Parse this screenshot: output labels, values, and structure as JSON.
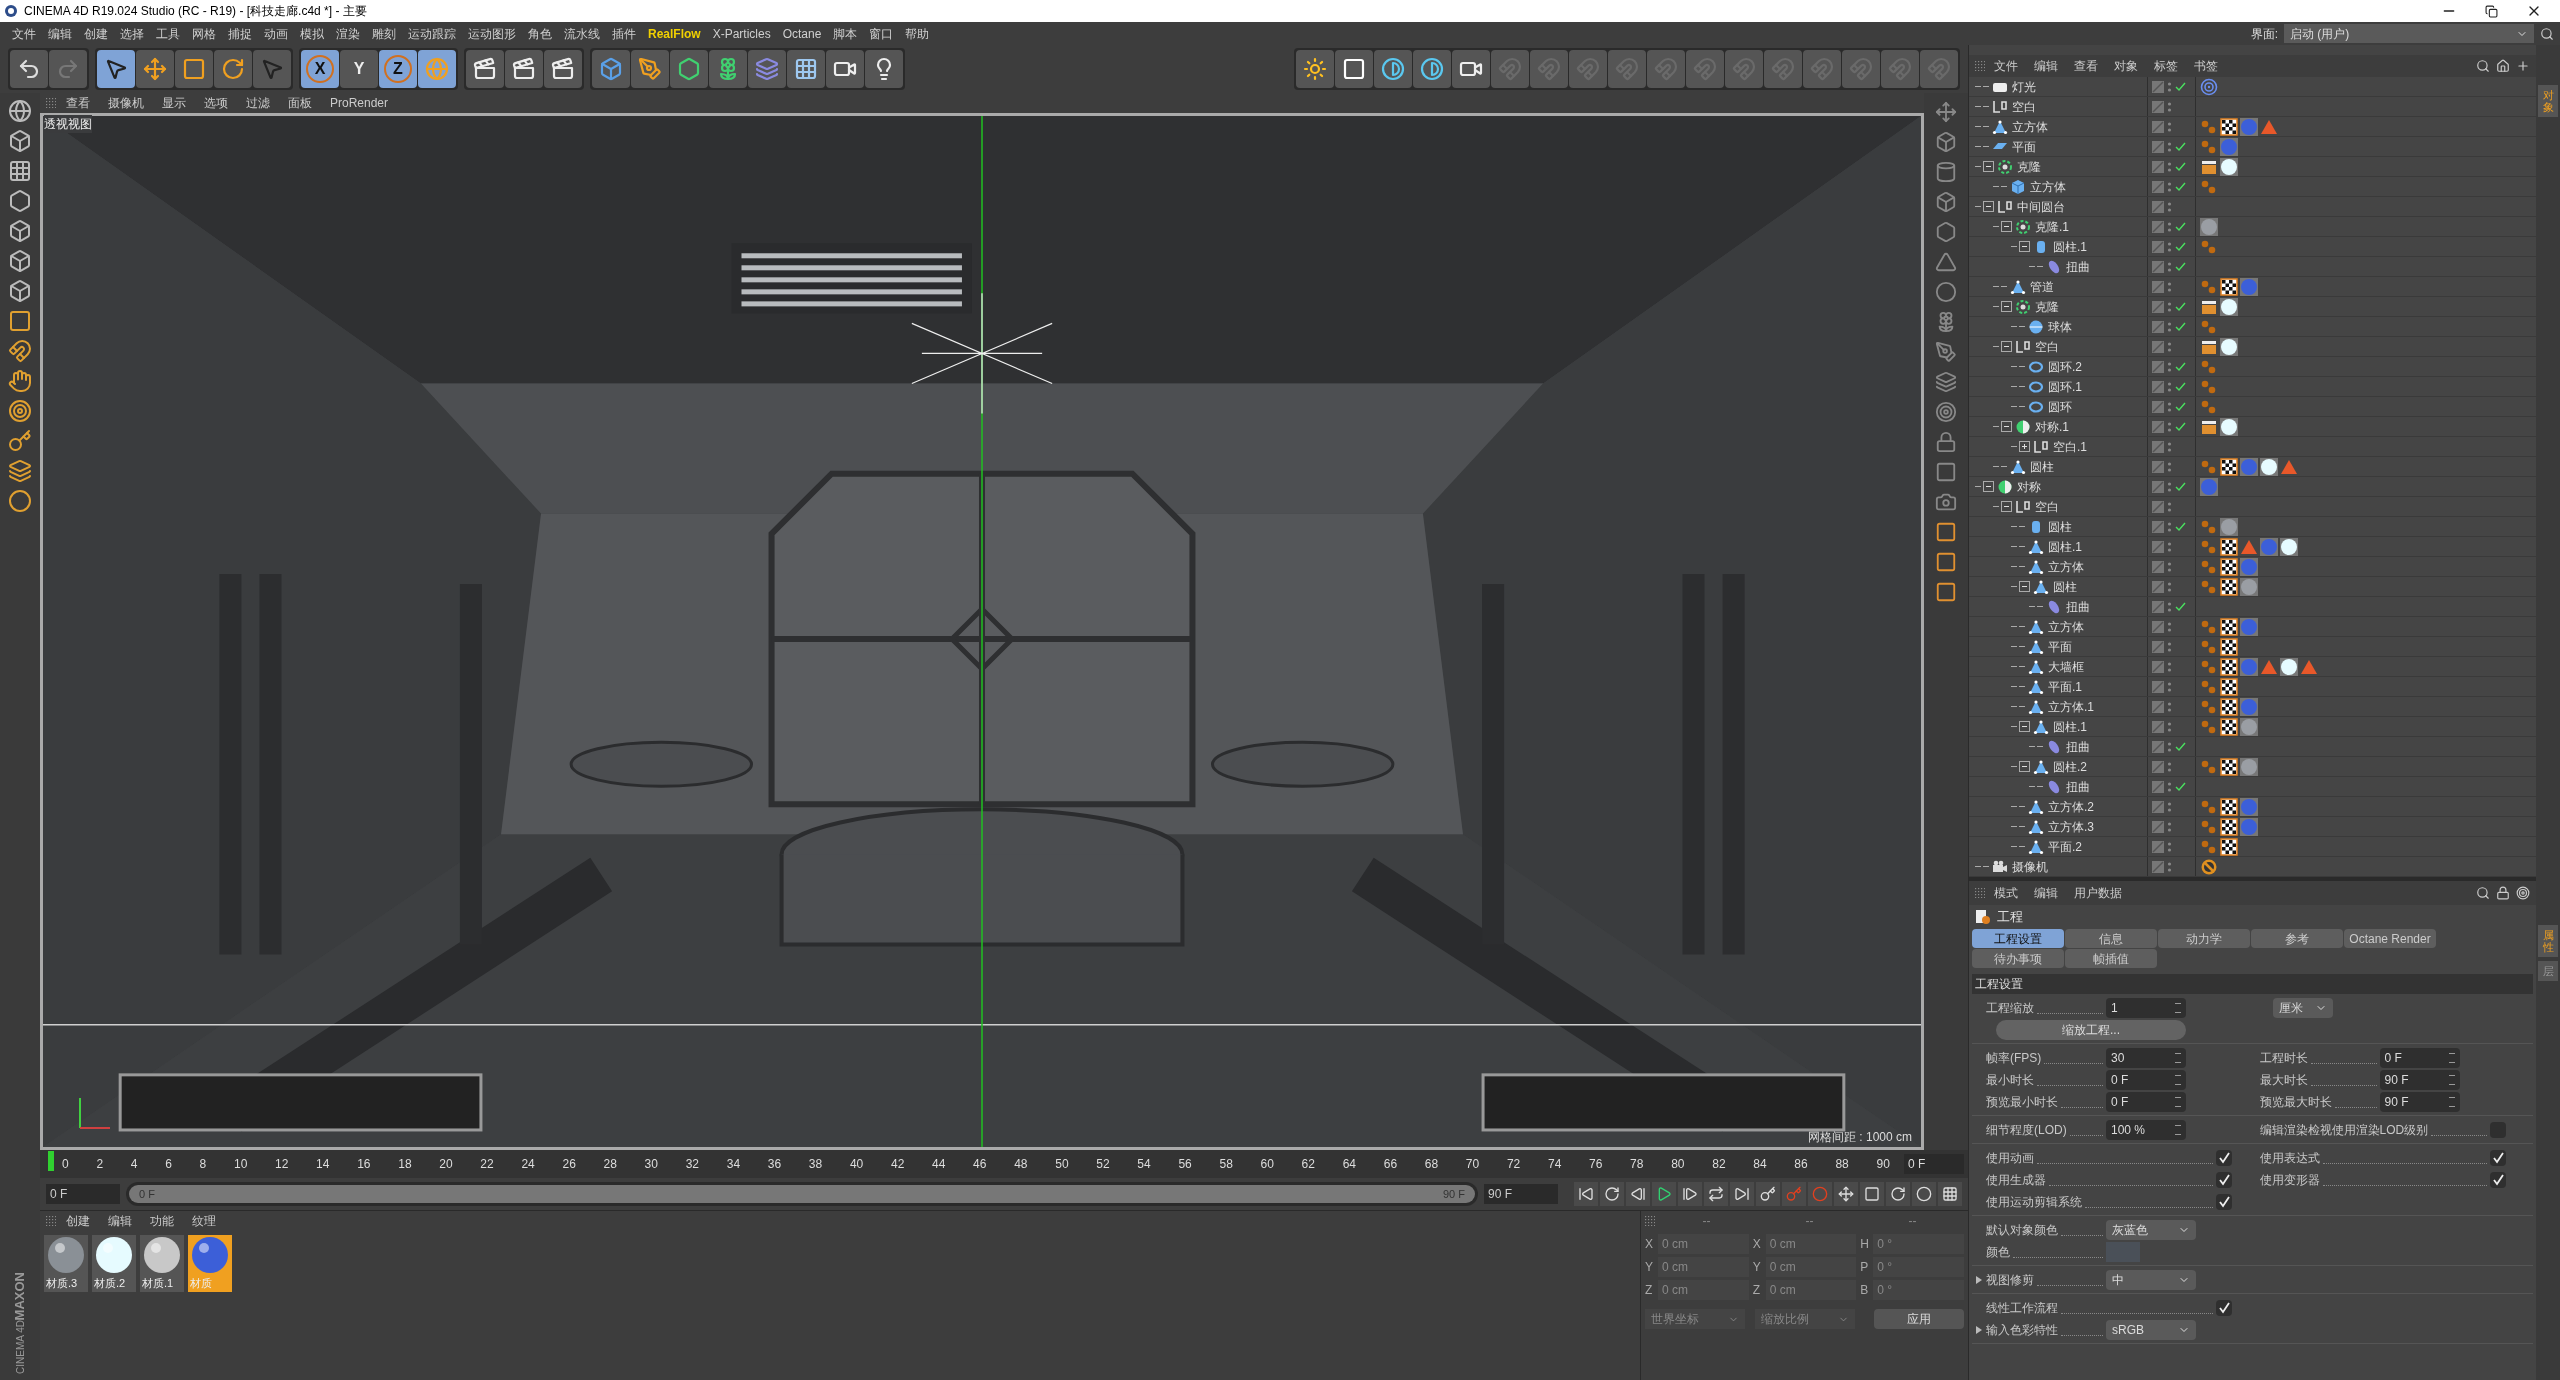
{
  "window": {
    "title": "CINEMA 4D R19.024 Studio (RC - R19) - [科技走廊.c4d *] - 主要"
  },
  "menu": [
    {
      "label": "文件",
      "highlighted": false
    },
    {
      "label": "编辑",
      "highlighted": false
    },
    {
      "label": "创建",
      "highlighted": false
    },
    {
      "label": "选择",
      "highlighted": false
    },
    {
      "label": "工具",
      "highlighted": false
    },
    {
      "label": "网格",
      "highlighted": false
    },
    {
      "label": "捕捉",
      "highlighted": false
    },
    {
      "label": "动画",
      "highlighted": false
    },
    {
      "label": "模拟",
      "highlighted": false
    },
    {
      "label": "渲染",
      "highlighted": false
    },
    {
      "label": "雕刻",
      "highlighted": false
    },
    {
      "label": "运动跟踪",
      "highlighted": false
    },
    {
      "label": "运动图形",
      "highlighted": false
    },
    {
      "label": "角色",
      "highlighted": false
    },
    {
      "label": "流水线",
      "highlighted": false
    },
    {
      "label": "插件",
      "highlighted": false
    },
    {
      "label": "RealFlow",
      "highlighted": true
    },
    {
      "label": "X-Particles",
      "highlighted": false
    },
    {
      "label": "Octane",
      "highlighted": false
    },
    {
      "label": "脚本",
      "highlighted": false
    },
    {
      "label": "窗口",
      "highlighted": false
    },
    {
      "label": "帮助",
      "highlighted": false
    }
  ],
  "layout": {
    "label": "界面:",
    "value": "启动 (用户)"
  },
  "toolbar": [
    [
      {
        "kind": "undo",
        "active": false
      },
      {
        "kind": "redo",
        "active": false
      }
    ],
    [
      {
        "kind": "select",
        "active": true
      },
      {
        "kind": "move",
        "active": false
      },
      {
        "kind": "scale",
        "active": false
      },
      {
        "kind": "rotate",
        "active": false
      },
      {
        "kind": "select",
        "active": false
      }
    ],
    [
      {
        "kind": "axis",
        "label": "X",
        "active": true
      },
      {
        "kind": "axis",
        "label": "Y",
        "active": false
      },
      {
        "kind": "axis",
        "label": "Z",
        "active": true
      },
      {
        "kind": "world",
        "active": true
      }
    ],
    [
      {
        "kind": "render",
        "active": false
      },
      {
        "kind": "render",
        "active": false
      },
      {
        "kind": "render",
        "active": false
      }
    ],
    [
      {
        "kind": "cube",
        "active": false
      },
      {
        "kind": "pen",
        "active": false
      },
      {
        "kind": "subdivide",
        "active": false
      },
      {
        "kind": "cloner",
        "active": false
      },
      {
        "kind": "deformer",
        "active": false
      },
      {
        "kind": "floor",
        "active": false
      },
      {
        "kind": "camera",
        "active": false
      },
      {
        "kind": "light",
        "active": false
      }
    ]
  ],
  "toolbar_right": [
    {
      "kind": "sun"
    },
    {
      "kind": "lamp"
    },
    {
      "kind": "contrast"
    },
    {
      "kind": "contrast"
    },
    {
      "kind": "camera"
    },
    {
      "kind": "faded"
    },
    {
      "kind": "faded"
    },
    {
      "kind": "faded"
    },
    {
      "kind": "faded"
    },
    {
      "kind": "faded"
    },
    {
      "kind": "faded"
    },
    {
      "kind": "faded"
    },
    {
      "kind": "faded"
    },
    {
      "kind": "faded"
    },
    {
      "kind": "faded"
    },
    {
      "kind": "faded"
    },
    {
      "kind": "faded"
    }
  ],
  "viewport": {
    "menu": [
      "查看",
      "摄像机",
      "显示",
      "选项",
      "过滤",
      "面板",
      "ProRender"
    ],
    "name": "透视视图",
    "grid": "网格间距 : 1000 cm"
  },
  "objects_panel": {
    "menu": [
      "文件",
      "编辑",
      "查看",
      "对象",
      "标签",
      "书签"
    ],
    "side_tab": "对象"
  },
  "objects": [
    {
      "name": "灯光",
      "kind": "light",
      "visible": true,
      "tags": [
        {
          "kind": "target"
        }
      ]
    },
    {
      "name": "空白",
      "kind": "null",
      "visible": false
    },
    {
      "name": "立方体",
      "kind": "poly",
      "visible": false,
      "tags": [
        {
          "kind": "phong"
        },
        {
          "kind": "checker"
        },
        {
          "kind": "material",
          "color": "#3c5fd8"
        },
        {
          "kind": "triangle"
        }
      ]
    },
    {
      "name": "平面",
      "kind": "plane",
      "visible": true,
      "tags": [
        {
          "kind": "phong"
        },
        {
          "kind": "material",
          "color": "#3c5fd8"
        }
      ]
    },
    {
      "name": "克隆",
      "kind": "cloner",
      "visible": true,
      "expanded": true,
      "tags": [
        {
          "kind": "clapper"
        },
        {
          "kind": "material",
          "color": "#e6fbff"
        }
      ],
      "children": [
        {
          "name": "立方体",
          "kind": "cube",
          "visible": true,
          "tags": [
            {
              "kind": "phong"
            }
          ]
        }
      ]
    },
    {
      "name": "中间圆台",
      "kind": "null",
      "visible": false,
      "expanded": true,
      "children": [
        {
          "name": "克隆.1",
          "kind": "cloner",
          "visible": true,
          "expanded": true,
          "tags": [
            {
              "kind": "material",
              "color": "#9a9ea4"
            }
          ],
          "children": [
            {
              "name": "圆柱.1",
              "kind": "cylinder",
              "visible": true,
              "expanded": true,
              "tags": [
                {
                  "kind": "phong"
                }
              ],
              "children": [
                {
                  "name": "扭曲",
                  "kind": "deformer",
                  "visible": true
                }
              ]
            }
          ]
        },
        {
          "name": "管道",
          "kind": "poly",
          "visible": false,
          "tags": [
            {
              "kind": "phong"
            },
            {
              "kind": "checker"
            },
            {
              "kind": "material",
              "color": "#3c5fd8"
            }
          ]
        },
        {
          "name": "克隆",
          "kind": "cloner",
          "visible": true,
          "expanded": true,
          "tags": [
            {
              "kind": "clapper"
            },
            {
              "kind": "material",
              "color": "#e6fbff"
            }
          ],
          "children": [
            {
              "name": "球体",
              "kind": "sphere",
              "visible": true,
              "tags": [
                {
                  "kind": "phong"
                }
              ]
            }
          ]
        },
        {
          "name": "空白",
          "kind": "null",
          "visible": false,
          "expanded": true,
          "tags": [
            {
              "kind": "clapper"
            },
            {
              "kind": "material",
              "color": "#e6fbff"
            }
          ],
          "children": [
            {
              "name": "圆环.2",
              "kind": "ring",
              "visible": true,
              "tags": [
                {
                  "kind": "phong"
                }
              ]
            },
            {
              "name": "圆环.1",
              "kind": "ring",
              "visible": true,
              "tags": [
                {
                  "kind": "phong"
                }
              ]
            },
            {
              "name": "圆环",
              "kind": "ring",
              "visible": true,
              "tags": [
                {
                  "kind": "phong"
                }
              ]
            }
          ]
        },
        {
          "name": "对称.1",
          "kind": "symmetry",
          "visible": true,
          "expanded": true,
          "tags": [
            {
              "kind": "clapper"
            },
            {
              "kind": "material",
              "color": "#e6fbff"
            }
          ],
          "children": [
            {
              "name": "空白.1",
              "kind": "null",
              "visible": false,
              "expanded": false
            }
          ]
        },
        {
          "name": "圆柱",
          "kind": "poly",
          "visible": false,
          "tags": [
            {
              "kind": "phong"
            },
            {
              "kind": "checker"
            },
            {
              "kind": "material",
              "color": "#3c5fd8"
            },
            {
              "kind": "material",
              "color": "#e6fbff"
            },
            {
              "kind": "triangle"
            }
          ]
        }
      ]
    },
    {
      "name": "对称",
      "kind": "symmetry",
      "visible": true,
      "expanded": true,
      "tags": [
        {
          "kind": "material",
          "color": "#3c5fd8"
        }
      ],
      "children": [
        {
          "name": "空白",
          "kind": "null",
          "visible": false,
          "expanded": true,
          "children": [
            {
              "name": "圆柱",
              "kind": "cylinder",
              "visible": true,
              "tags": [
                {
                  "kind": "phong"
                },
                {
                  "kind": "material",
                  "color": "#9a9ea4"
                }
              ]
            },
            {
              "name": "圆柱.1",
              "kind": "poly",
              "visible": false,
              "tags": [
                {
                  "kind": "phong"
                },
                {
                  "kind": "checker"
                },
                {
                  "kind": "triangle"
                },
                {
                  "kind": "material",
                  "color": "#3c5fd8"
                },
                {
                  "kind": "material",
                  "color": "#e6fbff"
                }
              ]
            },
            {
              "name": "立方体",
              "kind": "poly",
              "visible": false,
              "tags": [
                {
                  "kind": "phong"
                },
                {
                  "kind": "checker"
                },
                {
                  "kind": "material",
                  "color": "#3c5fd8"
                }
              ]
            },
            {
              "name": "圆柱",
              "kind": "poly",
              "visible": false,
              "expanded": true,
              "tags": [
                {
                  "kind": "phong"
                },
                {
                  "kind": "checker"
                },
                {
                  "kind": "material",
                  "color": "#9a9ea4"
                }
              ],
              "children": [
                {
                  "name": "扭曲",
                  "kind": "deformer",
                  "visible": true
                }
              ]
            },
            {
              "name": "立方体",
              "kind": "poly",
              "visible": false,
              "tags": [
                {
                  "kind": "phong"
                },
                {
                  "kind": "checker"
                },
                {
                  "kind": "material",
                  "color": "#3c5fd8"
                }
              ]
            },
            {
              "name": "平面",
              "kind": "poly",
              "visible": false,
              "tags": [
                {
                  "kind": "phong"
                },
                {
                  "kind": "checker"
                }
              ]
            },
            {
              "name": "大墙框",
              "kind": "poly",
              "visible": false,
              "tags": [
                {
                  "kind": "phong"
                },
                {
                  "kind": "checker"
                },
                {
                  "kind": "material",
                  "color": "#3c5fd8"
                },
                {
                  "kind": "triangle"
                },
                {
                  "kind": "material",
                  "color": "#e6fbff"
                },
                {
                  "kind": "triangle"
                }
              ]
            },
            {
              "name": "平面.1",
              "kind": "poly",
              "visible": false,
              "tags": [
                {
                  "kind": "phong"
                },
                {
                  "kind": "checker"
                }
              ]
            },
            {
              "name": "立方体.1",
              "kind": "poly",
              "visible": false,
              "tags": [
                {
                  "kind": "phong"
                },
                {
                  "kind": "checker"
                },
                {
                  "kind": "material",
                  "color": "#3c5fd8"
                }
              ]
            },
            {
              "name": "圆柱.1",
              "kind": "poly",
              "visible": false,
              "expanded": true,
              "tags": [
                {
                  "kind": "phong"
                },
                {
                  "kind": "checker"
                },
                {
                  "kind": "material",
                  "color": "#9a9ea4"
                }
              ],
              "children": [
                {
                  "name": "扭曲",
                  "kind": "deformer",
                  "visible": true
                }
              ]
            },
            {
              "name": "圆柱.2",
              "kind": "poly",
              "visible": false,
              "expanded": true,
              "tags": [
                {
                  "kind": "phong"
                },
                {
                  "kind": "checker"
                },
                {
                  "kind": "material",
                  "color": "#9a9ea4"
                }
              ],
              "children": [
                {
                  "name": "扭曲",
                  "kind": "deformer",
                  "visible": true
                }
              ]
            },
            {
              "name": "立方体.2",
              "kind": "poly",
              "visible": false,
              "tags": [
                {
                  "kind": "phong"
                },
                {
                  "kind": "checker"
                },
                {
                  "kind": "material",
                  "color": "#3c5fd8"
                }
              ]
            },
            {
              "name": "立方体.3",
              "kind": "poly",
              "visible": false,
              "tags": [
                {
                  "kind": "phong"
                },
                {
                  "kind": "checker"
                },
                {
                  "kind": "material",
                  "color": "#3c5fd8"
                }
              ]
            },
            {
              "name": "平面.2",
              "kind": "poly",
              "visible": false,
              "tags": [
                {
                  "kind": "phong"
                },
                {
                  "kind": "checker"
                }
              ]
            }
          ]
        }
      ]
    },
    {
      "name": "摄像机",
      "kind": "camera",
      "visible": false,
      "tags": [
        {
          "kind": "prohibited"
        }
      ]
    }
  ],
  "attributes": {
    "menu": [
      "模式",
      "编辑",
      "用户数据"
    ],
    "side_tabs": [
      "属性",
      "层"
    ],
    "title": "工程",
    "tabs": [
      [
        {
          "label": "工程设置",
          "selected": true
        },
        {
          "label": "信息",
          "selected": false
        },
        {
          "label": "动力学",
          "selected": false
        },
        {
          "label": "参考",
          "selected": false
        },
        {
          "label": "Octane Render",
          "selected": false
        }
      ],
      [
        {
          "label": "待办事项",
          "selected": false
        },
        {
          "label": "帧插值",
          "selected": false
        }
      ]
    ],
    "section": "工程设置",
    "groups": [
      [
        [
          {
            "kind": "number",
            "label": "工程缩放",
            "value": "1"
          },
          {
            "kind": "unit",
            "value": "厘米"
          }
        ],
        [
          {
            "kind": "button",
            "value": "缩放工程..."
          }
        ]
      ],
      [
        [
          {
            "kind": "number",
            "label": "帧率(FPS)",
            "value": "30"
          },
          {
            "kind": "number",
            "label": "工程时长",
            "value": "0 F"
          }
        ],
        [
          {
            "kind": "number",
            "label": "最小时长",
            "value": "0 F"
          },
          {
            "kind": "number",
            "label": "最大时长",
            "value": "90 F"
          }
        ],
        [
          {
            "kind": "number",
            "label": "预览最小时长",
            "value": "0 F"
          },
          {
            "kind": "number",
            "label": "预览最大时长",
            "value": "90 F"
          }
        ]
      ],
      [
        [
          {
            "kind": "number",
            "label": "细节程度(LOD)",
            "value": "100 %"
          },
          {
            "kind": "check",
            "label": "编辑渲染检视使用渲染LOD级别",
            "checked": false
          }
        ]
      ],
      [
        [
          {
            "kind": "check",
            "label": "使用动画",
            "checked": true
          },
          {
            "kind": "check",
            "label": "使用表达式",
            "checked": true
          }
        ],
        [
          {
            "kind": "check",
            "label": "使用生成器",
            "checked": true
          },
          {
            "kind": "check",
            "label": "使用变形器",
            "checked": true
          }
        ],
        [
          {
            "kind": "check",
            "label": "使用运动剪辑系统",
            "checked": true
          }
        ]
      ],
      [
        [
          {
            "kind": "dropdown",
            "label": "默认对象颜色",
            "value": "灰蓝色"
          }
        ],
        [
          {
            "kind": "color",
            "label": "颜色",
            "color": "#4a5058"
          }
        ]
      ],
      [
        [
          {
            "kind": "dropdown",
            "label": "视图修剪",
            "value": "中",
            "expander": true
          }
        ]
      ],
      [
        [
          {
            "kind": "check",
            "label": "线性工作流程",
            "checked": true
          }
        ],
        [
          {
            "kind": "dropdown",
            "label": "输入色彩特性",
            "value": "sRGB",
            "expander": true
          }
        ]
      ]
    ]
  },
  "timeline": {
    "ticks": [
      "0",
      "2",
      "4",
      "6",
      "8",
      "10",
      "12",
      "14",
      "16",
      "18",
      "20",
      "22",
      "24",
      "26",
      "28",
      "30",
      "32",
      "34",
      "36",
      "38",
      "40",
      "42",
      "44",
      "46",
      "48",
      "50",
      "52",
      "54",
      "56",
      "58",
      "60",
      "62",
      "64",
      "66",
      "68",
      "70",
      "72",
      "74",
      "76",
      "78",
      "80",
      "82",
      "84",
      "86",
      "88",
      "90"
    ],
    "current": "0 F",
    "playhead": {
      "level": 0
    },
    "range": {
      "level": 1
    },
    "start": "0 F",
    "range_start": "0 F",
    "range_end": "90 F",
    "end": "90 F"
  },
  "materials_panel": {
    "menu": [
      "创建",
      "编辑",
      "功能",
      "纹理"
    ],
    "materials": [
      {
        "name": "材质.3",
        "color": "#8a9096",
        "selected": false
      },
      {
        "name": "材质.2",
        "color": "#e6fbff",
        "selected": false
      },
      {
        "name": "材质.1",
        "color": "#c8c8c8",
        "selected": false
      },
      {
        "name": "材质",
        "color": "#3c5fd8",
        "selected": true
      }
    ]
  },
  "coordinates": {
    "headers": [
      "--",
      "--",
      "--"
    ],
    "rows": [
      {
        "axes": [
          "X",
          "X",
          "H"
        ],
        "values": [
          "0 cm",
          "0 cm",
          "0 °"
        ]
      },
      {
        "axes": [
          "Y",
          "Y",
          "P"
        ],
        "values": [
          "0 cm",
          "0 cm",
          "0 °"
        ]
      },
      {
        "axes": [
          "Z",
          "Z",
          "B"
        ],
        "values": [
          "0 cm",
          "0 cm",
          "0 °"
        ]
      }
    ],
    "dropdowns": [
      "世界坐标",
      "缩放比例"
    ],
    "apply": "应用"
  },
  "logo": [
    "MAXON",
    "CINEMA 4D"
  ]
}
